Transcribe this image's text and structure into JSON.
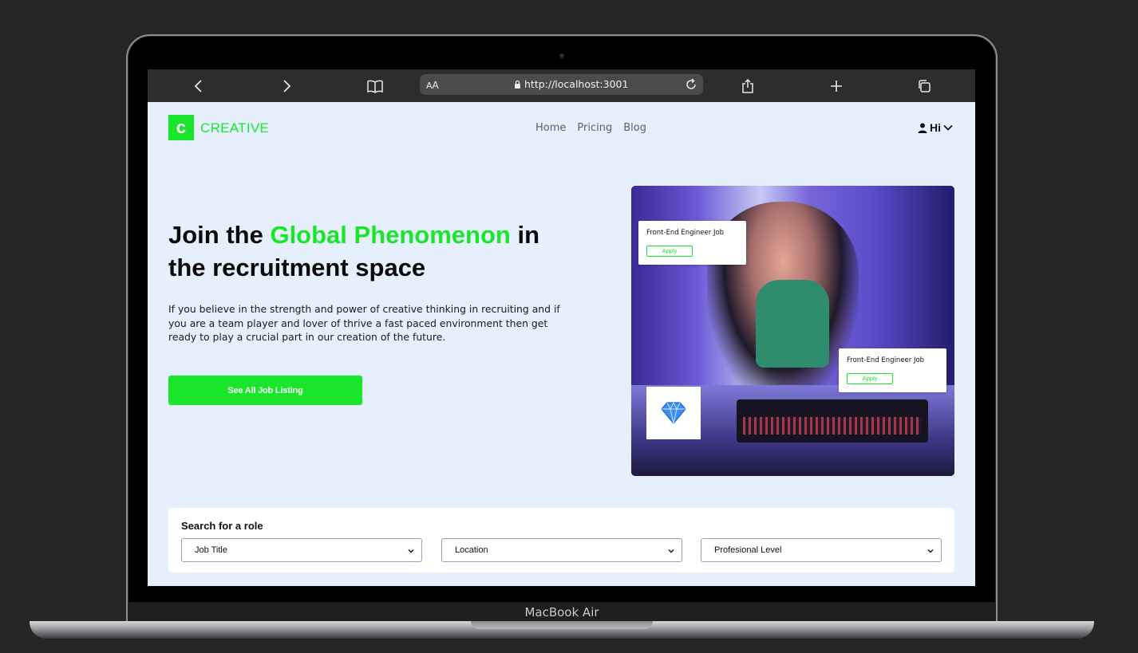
{
  "device": {
    "label": "MacBook Air"
  },
  "browser": {
    "text_size_label_small": "A",
    "text_size_label_big": "A",
    "url": "http://localhost:3001",
    "icons": [
      "chevron-left-icon",
      "chevron-right-icon",
      "book-icon",
      "lock-icon",
      "reload-icon",
      "share-icon",
      "plus-icon",
      "tabs-icon"
    ]
  },
  "header": {
    "logo_letter": "c",
    "logo_text": "CREATIVE",
    "nav": [
      "Home",
      "Pricing",
      "Blog"
    ],
    "user_label": "Hi"
  },
  "hero": {
    "title_part1": "Join the ",
    "title_accent": "Global Phenomenon",
    "title_part2": " in the recruitment space",
    "description": "If you believe in the strength and power of creative thinking in recruiting and if you are a team player and lover of thrive a fast paced environment then get ready to play a crucial part in our creation of the future.",
    "cta_label": "See All Job Listing"
  },
  "image_cards": [
    {
      "title": "Front-End Engineer Job",
      "action": "Apply"
    },
    {
      "title": "Front-End Engineer Job",
      "action": "Apply"
    }
  ],
  "search": {
    "title": "Search for a role",
    "filters": [
      "Job Title",
      "Location",
      "Profesional Level"
    ]
  },
  "colors": {
    "accent": "#19e62b",
    "page_bg": "#e6f0fc",
    "toolbar": "#2d2d2e",
    "backdrop": "#262626"
  }
}
